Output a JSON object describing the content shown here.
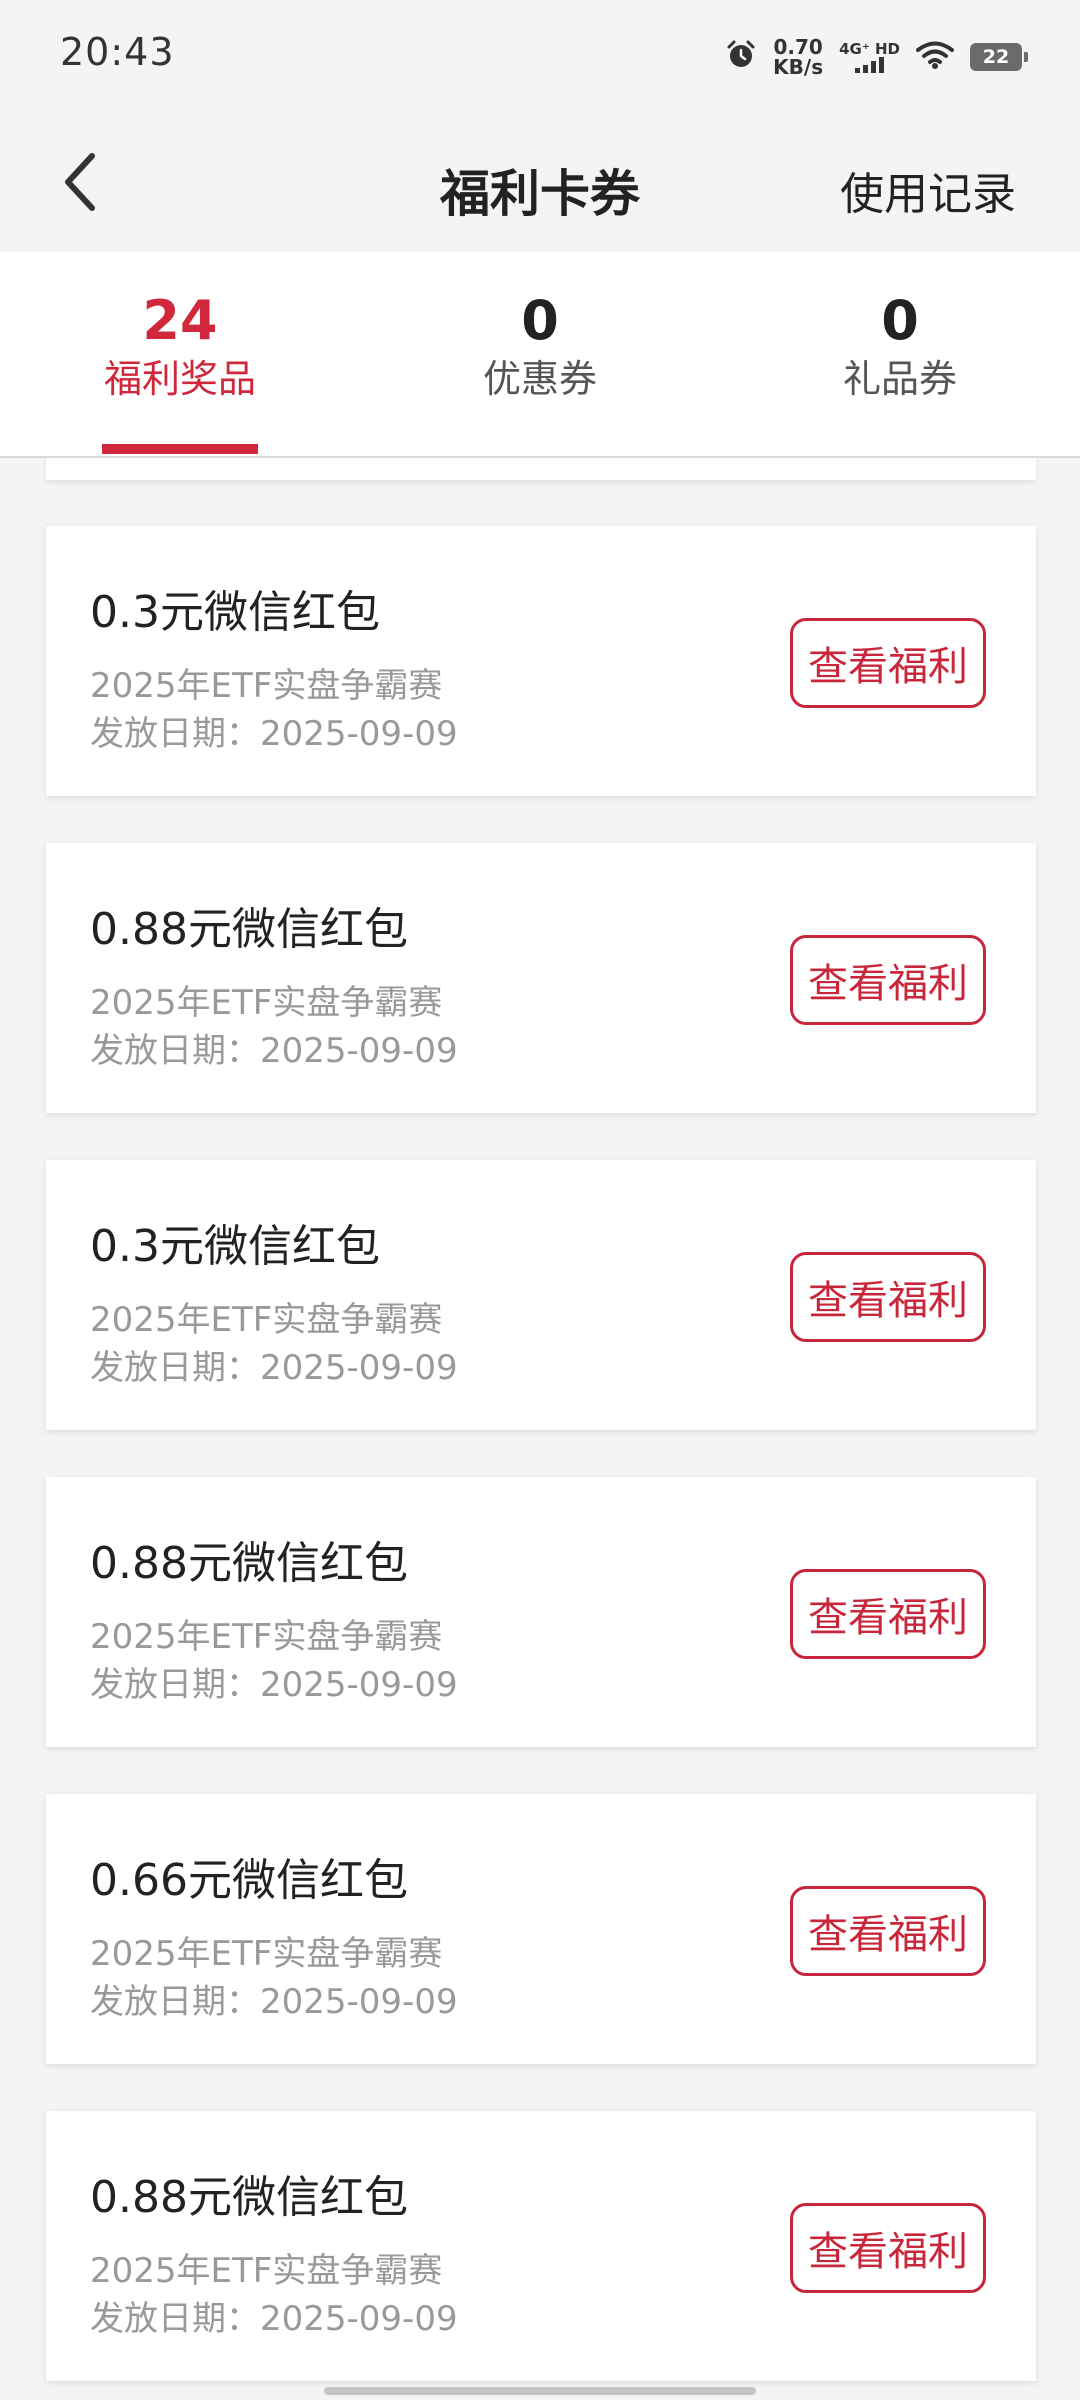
{
  "status_bar": {
    "time": "20:43",
    "net_speed_value": "0.70",
    "net_speed_unit": "KB/s",
    "net_type": "4G⁺ HD",
    "battery": "22"
  },
  "header": {
    "title": "福利卡券",
    "history_link": "使用记录"
  },
  "tabs": [
    {
      "count": "24",
      "label": "福利奖品",
      "active": true
    },
    {
      "count": "0",
      "label": "优惠券",
      "active": false
    },
    {
      "count": "0",
      "label": "礼品券",
      "active": false
    }
  ],
  "cards": [
    {
      "title": "0.3元微信红包",
      "event": "2025年ETF实盘争霸赛",
      "date": "发放日期：2025-09-09",
      "button": "查看福利"
    },
    {
      "title": "0.88元微信红包",
      "event": "2025年ETF实盘争霸赛",
      "date": "发放日期：2025-09-09",
      "button": "查看福利"
    },
    {
      "title": "0.3元微信红包",
      "event": "2025年ETF实盘争霸赛",
      "date": "发放日期：2025-09-09",
      "button": "查看福利"
    },
    {
      "title": "0.88元微信红包",
      "event": "2025年ETF实盘争霸赛",
      "date": "发放日期：2025-09-09",
      "button": "查看福利"
    },
    {
      "title": "0.66元微信红包",
      "event": "2025年ETF实盘争霸赛",
      "date": "发放日期：2025-09-09",
      "button": "查看福利"
    },
    {
      "title": "0.88元微信红包",
      "event": "2025年ETF实盘争霸赛",
      "date": "发放日期：2025-09-09",
      "button": "查看福利"
    }
  ],
  "colors": {
    "accent": "#d0283a",
    "background": "#f4f4f4",
    "muted_text": "#999999"
  }
}
